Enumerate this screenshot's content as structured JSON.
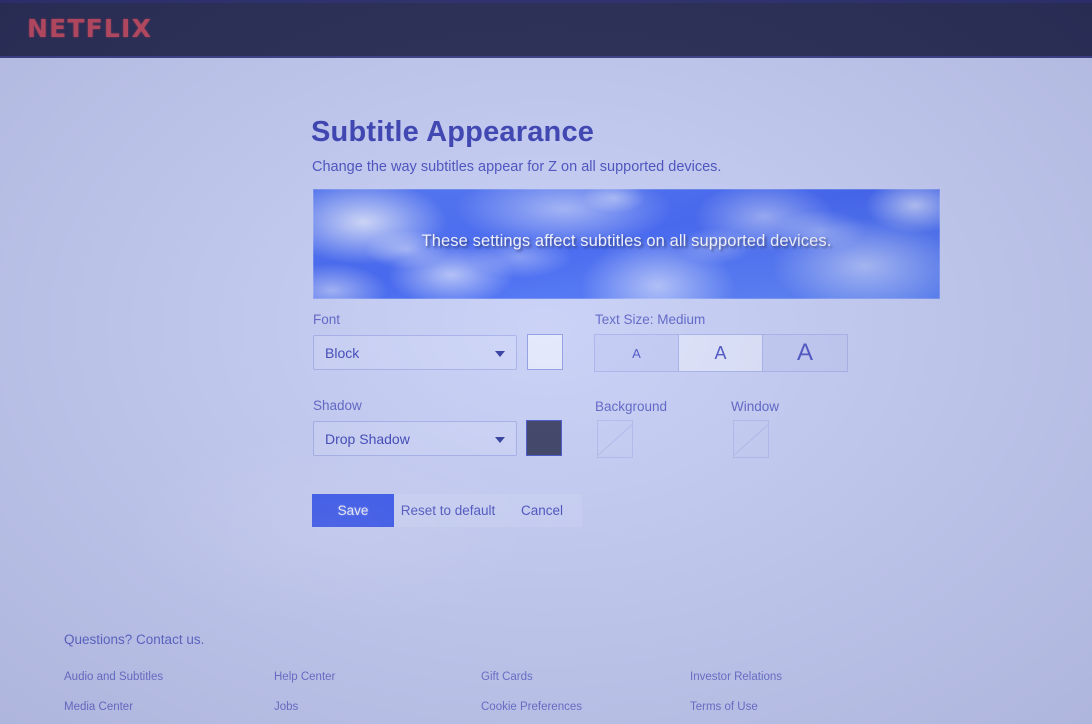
{
  "header": {
    "brand": "NETFLIX"
  },
  "page": {
    "title": "Subtitle Appearance",
    "description": "Change the way subtitles appear for Z on all supported devices."
  },
  "preview": {
    "text": "These settings affect subtitles on all supported devices."
  },
  "controls": {
    "font": {
      "label": "Font",
      "value": "Block",
      "color_swatch": "#e3e8fc"
    },
    "text_size": {
      "label": "Text Size: Medium",
      "selected": "Medium",
      "options": [
        {
          "label": "A",
          "size": "Small"
        },
        {
          "label": "A",
          "size": "Medium"
        },
        {
          "label": "A",
          "size": "Large"
        }
      ]
    },
    "shadow": {
      "label": "Shadow",
      "value": "Drop Shadow",
      "color_swatch": "#3a3f63"
    },
    "background": {
      "label": "Background",
      "value": "None"
    },
    "window": {
      "label": "Window",
      "value": "None"
    }
  },
  "actions": {
    "save": "Save",
    "reset": "Reset to default",
    "cancel": "Cancel"
  },
  "footer": {
    "contact": "Questions? Contact us.",
    "columns": [
      {
        "links": [
          "Audio and Subtitles",
          "Media Center"
        ]
      },
      {
        "links": [
          "Help Center",
          "Jobs"
        ]
      },
      {
        "links": [
          "Gift Cards",
          "Cookie Preferences"
        ]
      },
      {
        "links": [
          "Investor Relations",
          "Terms of Use"
        ]
      }
    ]
  },
  "colors": {
    "page_background": "#c7cff6",
    "topbar": "#272b52",
    "brand_red": "#c0485e",
    "accent_blue": "#3352ee",
    "title_blue": "#3a41b4"
  }
}
